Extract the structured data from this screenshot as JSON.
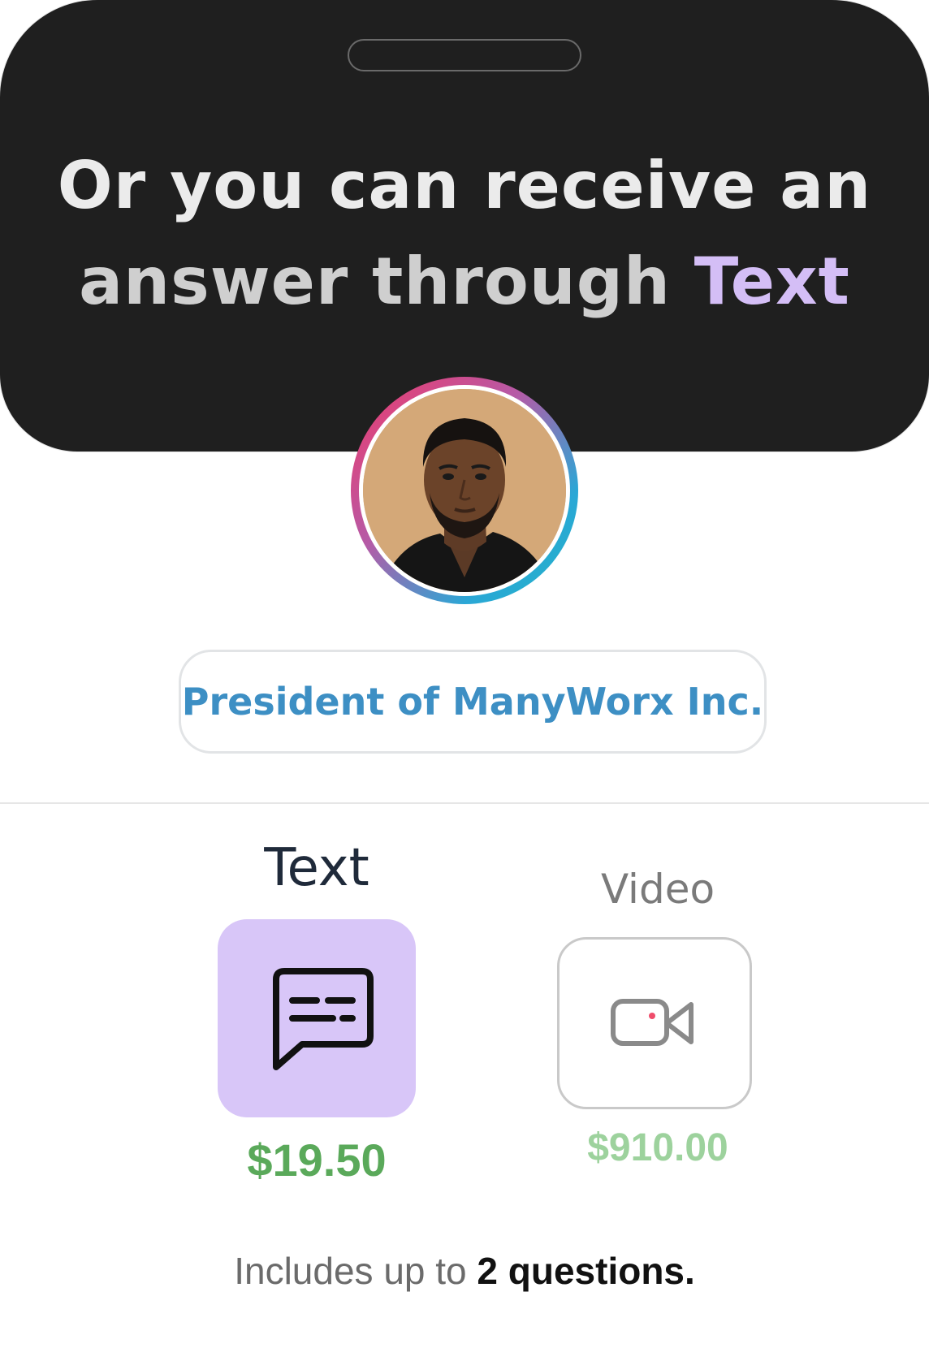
{
  "hero": {
    "headline_line1": "Or you can receive an",
    "headline_line2_prefix": "answer through ",
    "headline_accent": "Text"
  },
  "profile": {
    "avatar_icon": "person-portrait",
    "title": "President of ManyWorx Inc."
  },
  "options": {
    "text": {
      "label": "Text",
      "icon": "chat-bubble-icon",
      "price": "$19.50",
      "selected": true
    },
    "video": {
      "label": "Video",
      "icon": "video-camera-icon",
      "price": "$910.00",
      "selected": false
    }
  },
  "includes": {
    "prefix": "Includes up to ",
    "bold": "2 questions."
  },
  "colors": {
    "accent_purple": "#d4bef6",
    "selected_card": "#d8c6f8",
    "title_blue": "#3d8fc4",
    "price_green": "#5aa95a",
    "price_green_muted": "#9dd29d",
    "hero_bg": "#1f1f1f"
  }
}
